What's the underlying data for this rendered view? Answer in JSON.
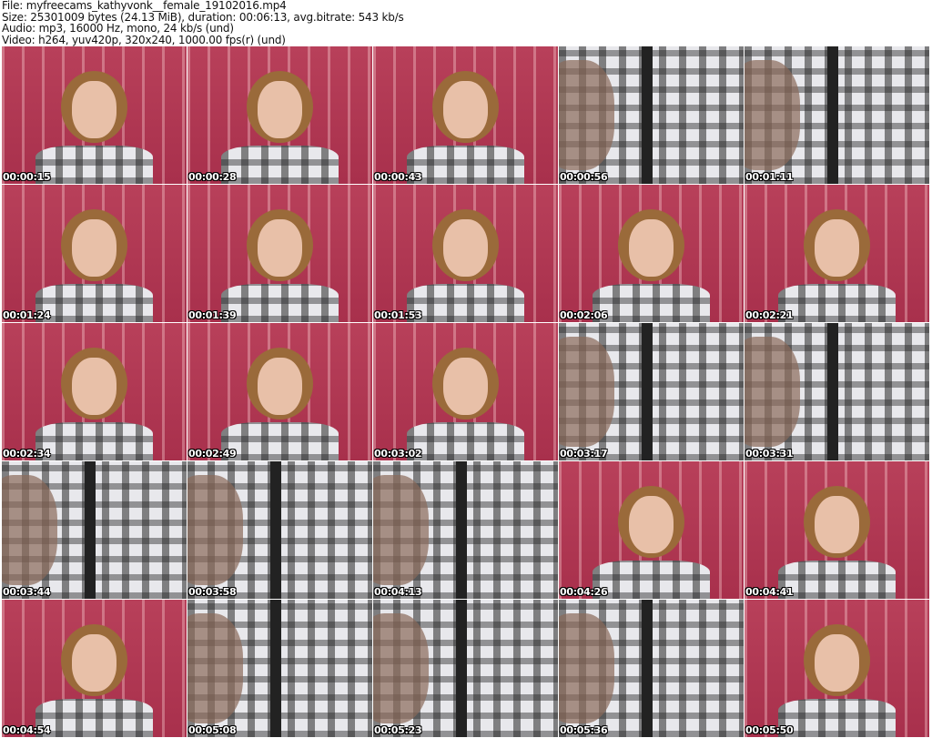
{
  "header": {
    "file": "File: myfreecams_kathyvonk__female_19102016.mp4",
    "size": "Size: 25301009 bytes (24.13 MiB), duration: 00:06:13, avg.bitrate: 543 kb/s",
    "audio": "Audio: mp3, 16000 Hz, mono, 24 kb/s (und)",
    "video": "Video: h264, yuv420p, 320x240, 1000.00 fps(r) (und)"
  },
  "thumbnails": [
    {
      "time": "00:00:15",
      "scene": "face"
    },
    {
      "time": "00:00:28",
      "scene": "face"
    },
    {
      "time": "00:00:43",
      "scene": "face"
    },
    {
      "time": "00:00:56",
      "scene": "plaid"
    },
    {
      "time": "00:01:11",
      "scene": "plaid"
    },
    {
      "time": "00:01:24",
      "scene": "face"
    },
    {
      "time": "00:01:39",
      "scene": "face"
    },
    {
      "time": "00:01:53",
      "scene": "face"
    },
    {
      "time": "00:02:06",
      "scene": "face"
    },
    {
      "time": "00:02:21",
      "scene": "face"
    },
    {
      "time": "00:02:34",
      "scene": "face"
    },
    {
      "time": "00:02:49",
      "scene": "face"
    },
    {
      "time": "00:03:02",
      "scene": "face"
    },
    {
      "time": "00:03:17",
      "scene": "plaid"
    },
    {
      "time": "00:03:31",
      "scene": "plaid"
    },
    {
      "time": "00:03:44",
      "scene": "plaid"
    },
    {
      "time": "00:03:58",
      "scene": "plaid"
    },
    {
      "time": "00:04:13",
      "scene": "plaid"
    },
    {
      "time": "00:04:26",
      "scene": "face"
    },
    {
      "time": "00:04:41",
      "scene": "face"
    },
    {
      "time": "00:04:54",
      "scene": "face"
    },
    {
      "time": "00:05:08",
      "scene": "plaid"
    },
    {
      "time": "00:05:23",
      "scene": "plaid"
    },
    {
      "time": "00:05:36",
      "scene": "plaid"
    },
    {
      "time": "00:05:50",
      "scene": "face"
    }
  ]
}
